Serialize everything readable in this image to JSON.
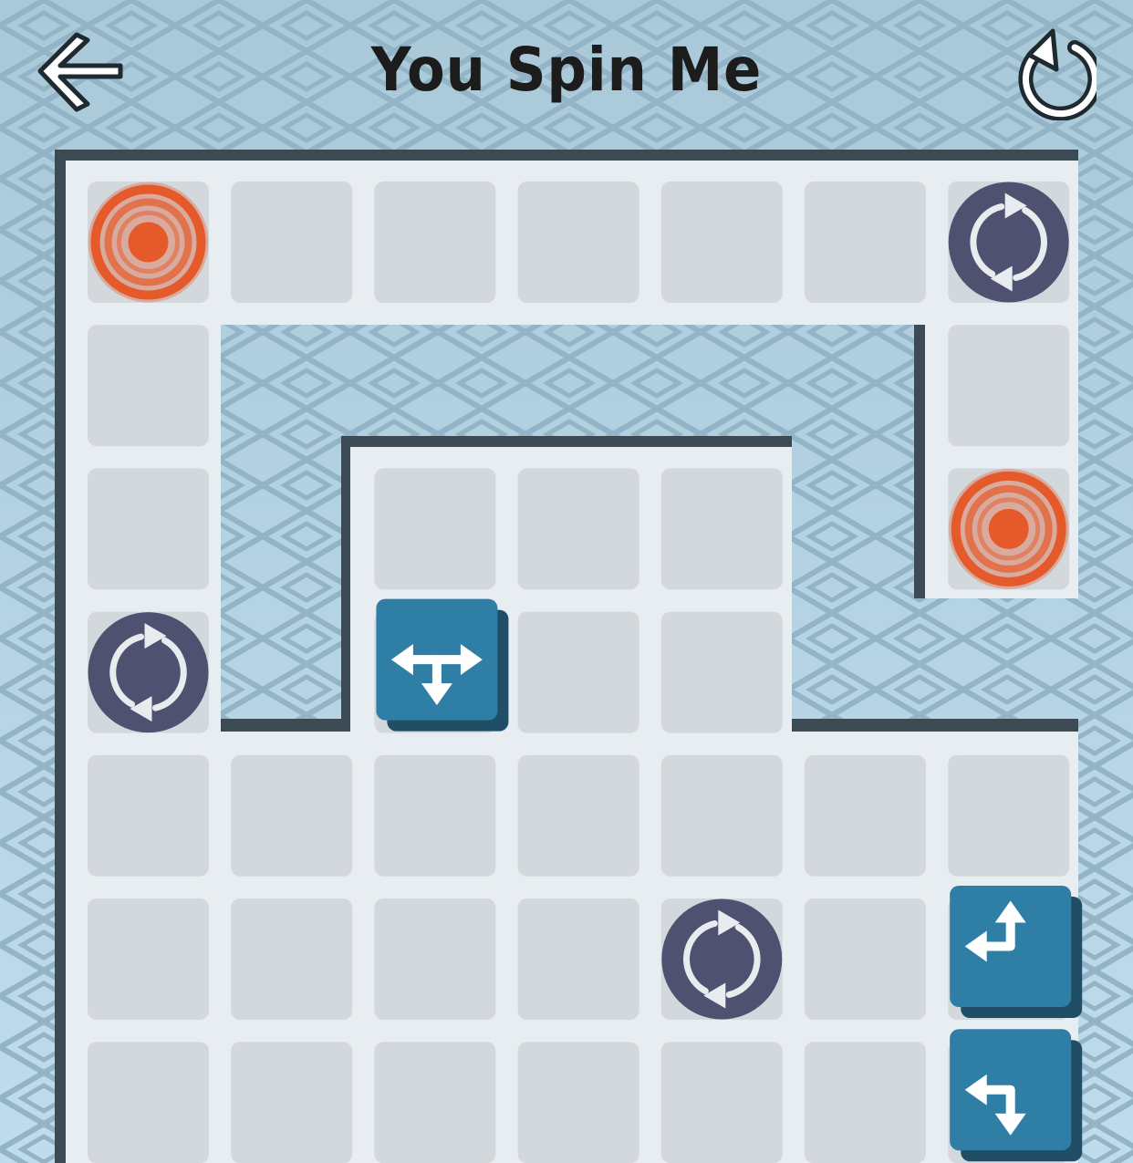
{
  "header": {
    "title": "You Spin Me",
    "back_icon": "arrow-left-icon",
    "restart_icon": "restart-icon"
  },
  "colors": {
    "background": "#b3d2e2",
    "pattern": "#8fb1c4",
    "wall": "#3c4a53",
    "floor": "#e8edf1",
    "tile": "#d3d8dc",
    "target": "#e55a2a",
    "rotator": "#4e5170",
    "block": "#2e7ea6",
    "block_shadow": "#1f4e66"
  },
  "grid": {
    "cols": 7,
    "rows": 7,
    "tiles": [
      [
        0,
        0
      ],
      [
        1,
        0
      ],
      [
        2,
        0
      ],
      [
        3,
        0
      ],
      [
        4,
        0
      ],
      [
        5,
        0
      ],
      [
        6,
        0
      ],
      [
        0,
        1
      ],
      [
        6,
        1
      ],
      [
        0,
        2
      ],
      [
        2,
        2
      ],
      [
        3,
        2
      ],
      [
        4,
        2
      ],
      [
        6,
        2
      ],
      [
        0,
        3
      ],
      [
        2,
        3
      ],
      [
        3,
        3
      ],
      [
        4,
        3
      ],
      [
        0,
        4
      ],
      [
        1,
        4
      ],
      [
        2,
        4
      ],
      [
        3,
        4
      ],
      [
        4,
        4
      ],
      [
        5,
        4
      ],
      [
        6,
        4
      ],
      [
        0,
        5
      ],
      [
        1,
        5
      ],
      [
        2,
        5
      ],
      [
        3,
        5
      ],
      [
        4,
        5
      ],
      [
        5,
        5
      ],
      [
        6,
        5
      ],
      [
        0,
        6
      ],
      [
        1,
        6
      ],
      [
        2,
        6
      ],
      [
        3,
        6
      ],
      [
        4,
        6
      ],
      [
        5,
        6
      ],
      [
        6,
        6
      ]
    ]
  },
  "pieces": [
    {
      "type": "target",
      "icon": "target-icon",
      "col": 0,
      "row": 0
    },
    {
      "type": "target",
      "icon": "target-icon",
      "col": 6,
      "row": 2
    },
    {
      "type": "rotator",
      "icon": "rotate-icon",
      "col": 6,
      "row": 0
    },
    {
      "type": "rotator",
      "icon": "rotate-icon",
      "col": 0,
      "row": 3
    },
    {
      "type": "rotator",
      "icon": "rotate-icon",
      "col": 4,
      "row": 5
    },
    {
      "type": "block",
      "icon": "arrows-left-right-down-icon",
      "arrows": [
        "left",
        "right",
        "down"
      ],
      "col": 2,
      "row": 3
    },
    {
      "type": "block",
      "icon": "arrows-left-up-icon",
      "arrows": [
        "left",
        "up"
      ],
      "col": 6,
      "row": 5
    },
    {
      "type": "block",
      "icon": "arrows-left-down-icon",
      "arrows": [
        "left",
        "down"
      ],
      "col": 6,
      "row": 6
    }
  ]
}
